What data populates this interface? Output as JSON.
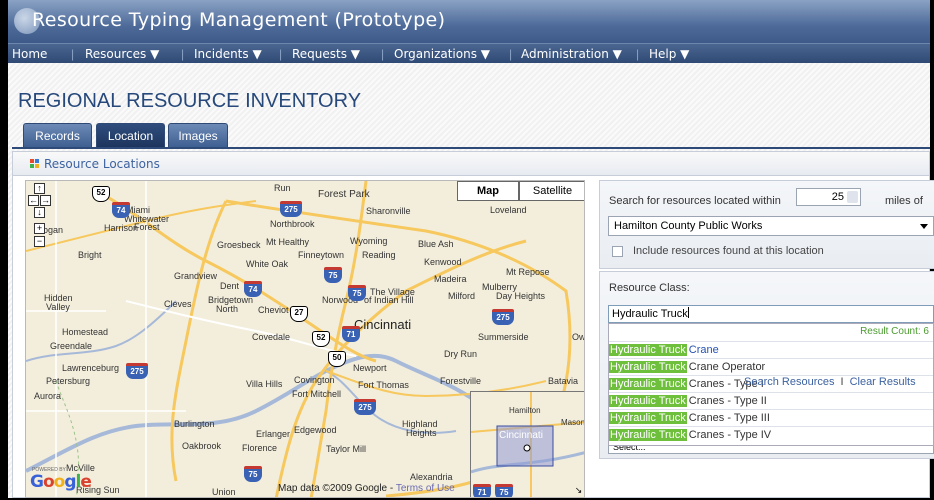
{
  "app": {
    "title": "Resource Typing Management (Prototype)"
  },
  "menu": [
    {
      "label": "Home"
    },
    {
      "label": "Resources ▼"
    },
    {
      "label": "Incidents ▼"
    },
    {
      "label": "Requests ▼"
    },
    {
      "label": "Organizations ▼"
    },
    {
      "label": "Administration ▼"
    },
    {
      "label": "Help ▼"
    }
  ],
  "page": {
    "title": "REGIONAL RESOURCE INVENTORY"
  },
  "tabs": [
    {
      "label": "Records",
      "active": false
    },
    {
      "label": "Location",
      "active": true
    },
    {
      "label": "Images",
      "active": false
    }
  ],
  "panel": {
    "title": "Resource Locations"
  },
  "map": {
    "type_buttons": {
      "map": "Map",
      "satellite": "Satellite"
    },
    "labels": {
      "run": "Run",
      "forest_park": "Forest Park",
      "sharonville": "Sharonville",
      "loveland": "Loveland",
      "miami": "Miami",
      "whitewater": "Whitewater",
      "forest": "Forest",
      "northbrook": "Northbrook",
      "logan": "Logan",
      "harrison": "Harrison",
      "groesbeck": "Groesbeck",
      "mt_healthy": "Mt Healthy",
      "wyoming": "Wyoming",
      "blue_ash": "Blue Ash",
      "bright": "Bright",
      "finneytown": "Finneytown",
      "reading": "Reading",
      "kenwood": "Kenwood",
      "white_oak": "White Oak",
      "grandview": "Grandview",
      "madeira": "Madeira",
      "mt_repose": "Mt Repose",
      "dent": "Dent",
      "mulberry": "Mulberry",
      "village_1": "The Village",
      "village_2": "of Indian Hill",
      "milford": "Milford",
      "day_heights": "Day Heights",
      "hidden_1": "Hidden",
      "hidden_2": "Valley",
      "cleves": "Cleves",
      "bridgetown": "Bridgetown",
      "north": "North",
      "cheviot": "Cheviot",
      "norwood": "Norwood",
      "cincinnati": "Cincinnati",
      "homestead": "Homestead",
      "greendale": "Greendale",
      "covedale": "Covedale",
      "summerside": "Summerside",
      "ow": "Ow",
      "dry_run": "Dry Run",
      "lawrenceburg": "Lawrenceburg",
      "newport": "Newport",
      "petersburg": "Petersburg",
      "villa_hills": "Villa Hills",
      "covington": "Covington",
      "fort_thomas": "Fort Thomas",
      "forestville": "Forestville",
      "batavia": "Batavia",
      "aurora": "Aurora",
      "fort_mitchell": "Fort Mitchell",
      "burlington": "Burlington",
      "erlanger": "Erlanger",
      "edgewood": "Edgewood",
      "highland_1": "Highland",
      "highland_2": "Heights",
      "oakbrook": "Oakbrook",
      "florence": "Florence",
      "taylor_mill": "Taylor Mill",
      "mcville": "McVille",
      "rising_sun": "Rising Sun",
      "union": "Union",
      "alexandria": "Alexandria",
      "hamilton": "Hamilton",
      "mason": "Mason",
      "ov_cincinnati": "Cincinnati"
    },
    "shields": {
      "us52": "52",
      "i74": "74",
      "i275a": "275",
      "i75a": "75",
      "i74b": "74",
      "i75b": "75",
      "us27": "27",
      "i71": "71",
      "us52b": "52",
      "us50": "50",
      "i275b": "275",
      "i275c": "275",
      "i275d": "275",
      "i75c": "75",
      "i71b": "71",
      "i75d": "75"
    },
    "branding": {
      "powered": "POWERED BY",
      "google": "Google"
    },
    "attribution": {
      "data": "Map data ©2009 Google - ",
      "terms": "Terms of Use"
    }
  },
  "search": {
    "prefix": "Search for resources located within",
    "miles": "25",
    "suffix": "miles of",
    "location": "Hamilton County Public Works",
    "include_label": "Include resources found at this location"
  },
  "resource_class": {
    "label": "Resource Class:",
    "input_value": "Hydraulic Truck",
    "result_count": "Result Count: 6",
    "match": "Hydraulic Truck",
    "results": [
      "Crane",
      "Crane Operator",
      "Cranes - Type I",
      "Cranes - Type II",
      "Cranes - Type III",
      "Cranes - Type IV"
    ],
    "select_value": "Select..."
  },
  "actions": {
    "search": "Search Resources",
    "separator": "I",
    "clear": "Clear Results"
  },
  "colors": {
    "brand_blue": "#3d5a88",
    "highlight_green": "#6ec03c",
    "link": "#3c62a0"
  }
}
